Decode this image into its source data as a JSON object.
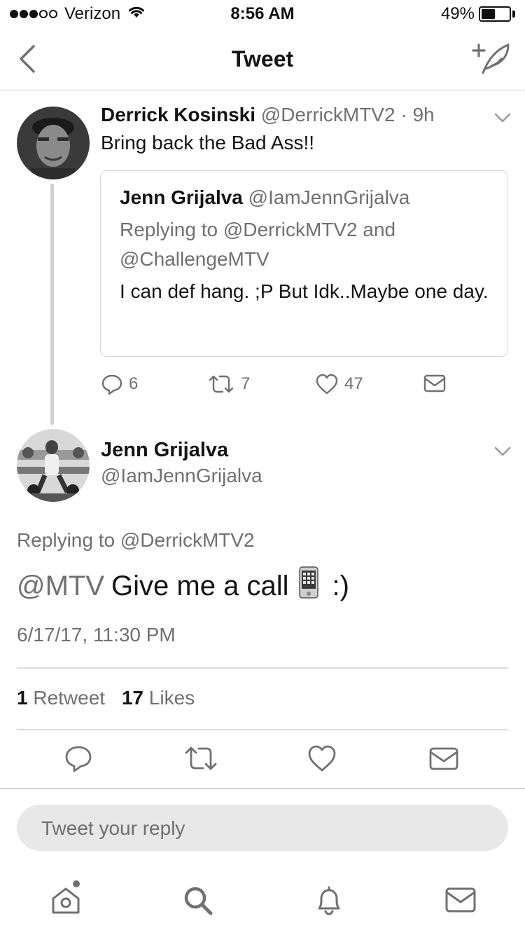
{
  "status_bar": {
    "carrier": "Verizon",
    "time": "8:56 AM",
    "battery_percent": "49%",
    "battery_level": 0.49,
    "signal_bars_filled": 3,
    "signal_bars_total": 5
  },
  "nav": {
    "title": "Tweet",
    "back_icon": "chevron-left-icon",
    "compose_icon": "compose-tweet-icon"
  },
  "parent_tweet": {
    "author_name": "Derrick Kosinski",
    "author_handle": "@DerrickMTV2",
    "separator": "·",
    "age": "9h",
    "text": "Bring back the Bad Ass!!",
    "quoted": {
      "author_name": "Jenn Grijalva",
      "author_handle": "@IamJennGrijalva",
      "replying_to": "Replying to @DerrickMTV2 and @ChallengeMTV",
      "text": "I can def hang. ;P But Idk..Maybe one day."
    },
    "actions": {
      "replies": "6",
      "retweets": "7",
      "likes": "47"
    }
  },
  "focused_tweet": {
    "author_name": "Jenn Grijalva",
    "author_handle": "@IamJennGrijalva",
    "replying_to": "Replying to @DerrickMTV2",
    "mention": "@MTV",
    "text_main": "Give me a call",
    "text_end": ":)",
    "timestamp": "6/17/17, 11:30 PM",
    "retweet_count": "1",
    "retweet_label": "Retweet",
    "like_count": "17",
    "like_label": "Likes"
  },
  "reply_box": {
    "placeholder": "Tweet your reply"
  },
  "tab_bar": {
    "items": [
      "home-icon",
      "search-icon",
      "notifications-icon",
      "messages-icon"
    ]
  },
  "colors": {
    "text": "#141414",
    "muted": "#707070",
    "divider": "#d8d8d8",
    "reply_box_bg": "#e8e8e8"
  }
}
